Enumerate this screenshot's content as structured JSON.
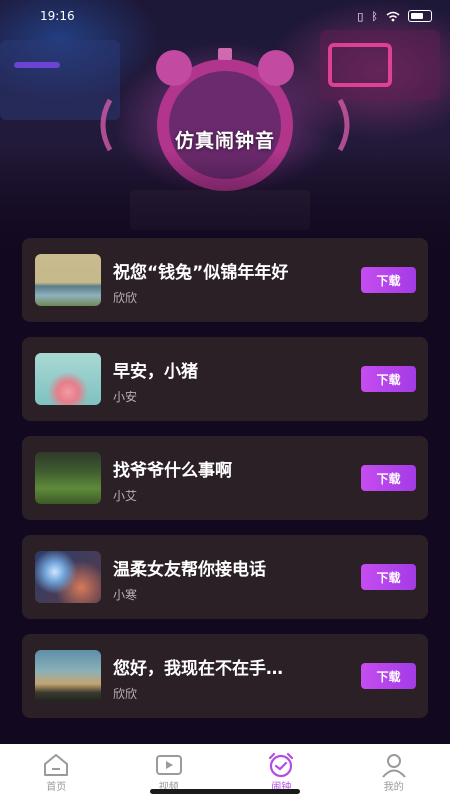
{
  "status_bar": {
    "time": "19:16"
  },
  "page": {
    "title": "仿真闹钟音"
  },
  "colors": {
    "accent": "#b44be8",
    "card_bg": "#2b2026",
    "background": "#12081f"
  },
  "list": {
    "download_label": "下载",
    "items": [
      {
        "title": "祝您“钱兔”似锦年年好",
        "author": "欣欣"
      },
      {
        "title": "早安，小猪",
        "author": "小安"
      },
      {
        "title": "找爷爷什么事啊",
        "author": "小艾"
      },
      {
        "title": "温柔女友帮你接电话",
        "author": "小寒"
      },
      {
        "title": "您好，我现在不在手…",
        "author": "欣欣"
      }
    ]
  },
  "tab_bar": {
    "tabs": [
      {
        "label": "首页",
        "icon": "home-icon"
      },
      {
        "label": "视频",
        "icon": "video-icon"
      },
      {
        "label": "闹钟",
        "icon": "alarm-clock-icon",
        "active": true
      },
      {
        "label": "我的",
        "icon": "user-icon"
      }
    ]
  }
}
